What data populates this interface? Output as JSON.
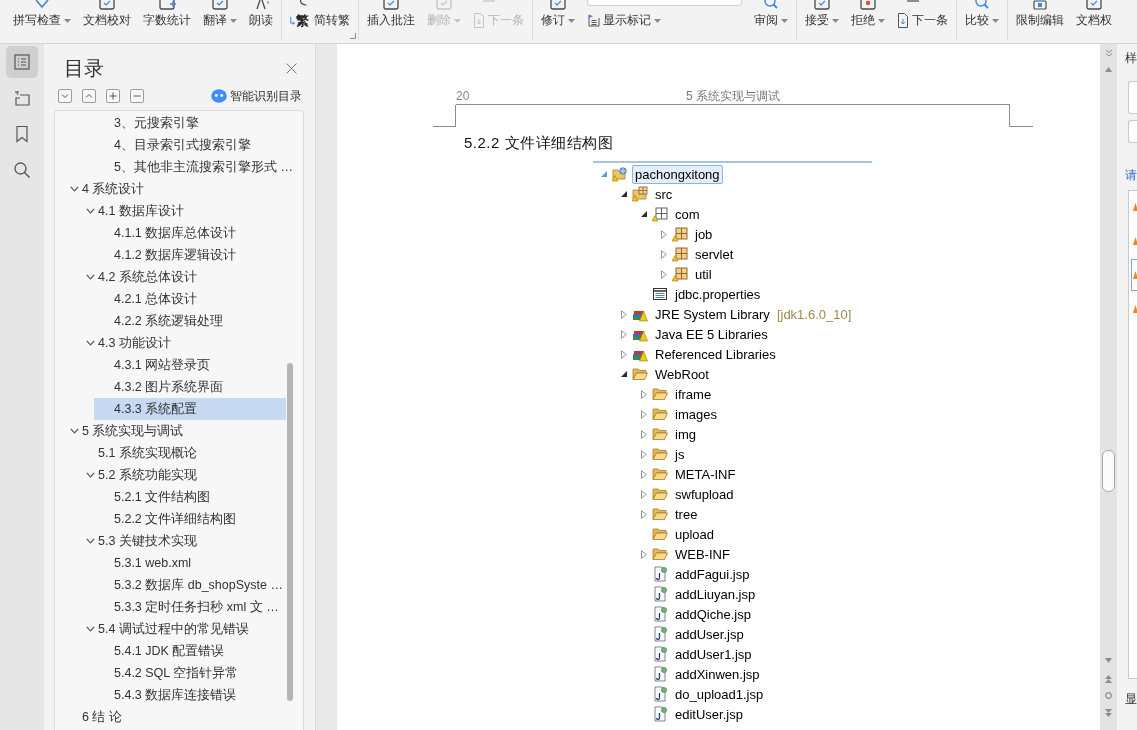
{
  "toolbar": {
    "groups": [
      {
        "items": [
          {
            "label": "拼写检查",
            "kind": "large",
            "dropdown": true,
            "disabled": false
          },
          {
            "label": "文档校对",
            "kind": "large",
            "dropdown": false,
            "disabled": false
          },
          {
            "label": "字数统计",
            "kind": "large",
            "dropdown": false,
            "disabled": false
          },
          {
            "label": "翻译",
            "kind": "large",
            "dropdown": true,
            "disabled": false
          },
          {
            "label": "朗读",
            "kind": "large",
            "dropdown": false,
            "disabled": false
          }
        ]
      },
      {
        "launcher": true,
        "items": [
          {
            "label": "简转繁",
            "kind": "glyph",
            "glyph": "繁",
            "dropdown": false,
            "disabled": false
          }
        ]
      },
      {
        "items": [
          {
            "label": "插入批注",
            "kind": "large",
            "dropdown": false,
            "disabled": false
          },
          {
            "label": "删除",
            "kind": "large",
            "dropdown": true,
            "disabled": true
          },
          {
            "label": "下一条",
            "kind": "small",
            "dropdown": false,
            "disabled": true
          }
        ]
      },
      {
        "items": [
          {
            "label": "修订",
            "kind": "large",
            "dropdown": true,
            "disabled": false
          },
          {
            "label": "显示标记",
            "kind": "field",
            "dropdown": true,
            "disabled": false
          },
          {
            "label": "审阅",
            "kind": "large",
            "dropdown": true,
            "disabled": false
          }
        ]
      },
      {
        "items": [
          {
            "label": "接受",
            "kind": "large",
            "dropdown": true,
            "disabled": false
          },
          {
            "label": "拒绝",
            "kind": "large",
            "dropdown": true,
            "disabled": false
          },
          {
            "label": "下一条",
            "kind": "small",
            "dropdown": false,
            "disabled": false
          }
        ]
      },
      {
        "items": [
          {
            "label": "比较",
            "kind": "large",
            "dropdown": true,
            "disabled": false
          }
        ]
      },
      {
        "items": [
          {
            "label": "限制编辑",
            "kind": "large",
            "dropdown": false,
            "disabled": false
          },
          {
            "label": "文档权",
            "kind": "large",
            "dropdown": false,
            "disabled": false
          }
        ]
      }
    ]
  },
  "nav_strip": {
    "tabs": [
      {
        "selected": true
      },
      {
        "selected": false
      },
      {
        "selected": false
      },
      {
        "selected": false
      }
    ]
  },
  "toc_panel": {
    "title": "目录",
    "smart_toc": "智能识别目录",
    "continued_items": [
      {
        "label": "3、元搜索引擎",
        "selected": false
      },
      {
        "label": "4、目录索引式搜索引擎",
        "selected": false
      },
      {
        "label": "5、其他非主流搜索引擎形式 …",
        "selected": false
      }
    ],
    "items": [
      {
        "label": "4 系统设计",
        "expanded": true,
        "selected": false,
        "children": [
          {
            "label": "4.1 数据库设计",
            "expanded": true,
            "selected": false,
            "children": [
              {
                "label": "4.1.1 数据库总体设计",
                "selected": false
              },
              {
                "label": "4.1.2 数据库逻辑设计",
                "selected": false
              }
            ]
          },
          {
            "label": "4.2 系统总体设计",
            "expanded": true,
            "selected": false,
            "children": [
              {
                "label": "4.2.1 总体设计",
                "selected": false
              },
              {
                "label": "4.2.2 系统逻辑处理",
                "selected": false
              }
            ]
          },
          {
            "label": "4.3 功能设计",
            "expanded": true,
            "selected": false,
            "children": [
              {
                "label": "4.3.1 网站登录页",
                "selected": false
              },
              {
                "label": "4.3.2 图片系统界面",
                "selected": false
              },
              {
                "label": "4.3.3 系统配置",
                "selected": true
              }
            ]
          }
        ]
      },
      {
        "label": "5 系统实现与调试",
        "expanded": true,
        "selected": false,
        "children": [
          {
            "label": "5.1 系统实现概论",
            "selected": false
          },
          {
            "label": "5.2 系统功能实现",
            "expanded": true,
            "selected": false,
            "children": [
              {
                "label": "5.2.1 文件结构图",
                "selected": false
              },
              {
                "label": "5.2.2 文件详细结构图",
                "selected": false
              }
            ]
          },
          {
            "label": "5.3 关键技术实现",
            "expanded": true,
            "selected": false,
            "children": [
              {
                "label": "5.3.1 web.xml",
                "selected": false
              },
              {
                "label": "5.3.2 数据库 db_shopSyste …",
                "selected": false
              },
              {
                "label": "5.3.3 定时任务扫秒 xml 文 …",
                "selected": false
              }
            ]
          },
          {
            "label": "5.4 调试过程中的常见错误",
            "expanded": true,
            "selected": false,
            "children": [
              {
                "label": "5.4.1 JDK 配置错误",
                "selected": false
              },
              {
                "label": "5.4.2 SQL 空指针异常",
                "selected": false
              },
              {
                "label": "5.4.3 数据库连接错误",
                "selected": false
              }
            ]
          }
        ]
      },
      {
        "label": "6 结 论",
        "selected": false
      }
    ]
  },
  "document": {
    "header": {
      "page_number": "20",
      "chapter": "5 系统实现与调试"
    },
    "heading": "5.2.2 文件详细结构图",
    "figure": {
      "tree": [
        {
          "label": "pachongxitong",
          "kind": "project",
          "expanded": true,
          "selected": true,
          "children": [
            {
              "label": "src",
              "kind": "source-folder",
              "expanded": true,
              "selected": false,
              "children": [
                {
                  "label": "com",
                  "kind": "empty-package",
                  "expanded": true,
                  "selected": false,
                  "children": [
                    {
                      "label": "job",
                      "kind": "package",
                      "expanded": false,
                      "selected": false
                    },
                    {
                      "label": "servlet",
                      "kind": "package",
                      "expanded": false,
                      "selected": false
                    },
                    {
                      "label": "util",
                      "kind": "package",
                      "expanded": false,
                      "selected": false
                    }
                  ]
                },
                {
                  "label": "jdbc.properties",
                  "kind": "properties",
                  "selected": false
                }
              ]
            },
            {
              "label": "JRE System Library",
              "decoration": "[jdk1.6.0_10]",
              "kind": "library",
              "expanded": false,
              "selected": false
            },
            {
              "label": "Java EE 5 Libraries",
              "kind": "library",
              "expanded": false,
              "selected": false
            },
            {
              "label": "Referenced Libraries",
              "kind": "library",
              "expanded": false,
              "selected": false
            },
            {
              "label": "WebRoot",
              "kind": "folder",
              "expanded": true,
              "selected": false,
              "children": [
                {
                  "label": "iframe",
                  "kind": "folder",
                  "expanded": false,
                  "selected": false
                },
                {
                  "label": "images",
                  "kind": "folder",
                  "expanded": false,
                  "selected": false
                },
                {
                  "label": "img",
                  "kind": "folder",
                  "expanded": false,
                  "selected": false
                },
                {
                  "label": "js",
                  "kind": "folder",
                  "expanded": false,
                  "selected": false
                },
                {
                  "label": "META-INF",
                  "kind": "folder",
                  "expanded": false,
                  "selected": false
                },
                {
                  "label": "swfupload",
                  "kind": "folder",
                  "expanded": false,
                  "selected": false
                },
                {
                  "label": "tree",
                  "kind": "folder",
                  "expanded": false,
                  "selected": false
                },
                {
                  "label": "upload",
                  "kind": "folder",
                  "selected": false
                },
                {
                  "label": "WEB-INF",
                  "kind": "folder",
                  "expanded": false,
                  "selected": false
                },
                {
                  "label": "addFagui.jsp",
                  "kind": "jsp",
                  "selected": false
                },
                {
                  "label": "addLiuyan.jsp",
                  "kind": "jsp",
                  "selected": false
                },
                {
                  "label": "addQiche.jsp",
                  "kind": "jsp",
                  "selected": false
                },
                {
                  "label": "addUser.jsp",
                  "kind": "jsp",
                  "selected": false
                },
                {
                  "label": "addUser1.jsp",
                  "kind": "jsp",
                  "selected": false
                },
                {
                  "label": "addXinwen.jsp",
                  "kind": "jsp",
                  "selected": false
                },
                {
                  "label": "do_upload1.jsp",
                  "kind": "jsp",
                  "selected": false
                },
                {
                  "label": "editUser.jsp",
                  "kind": "jsp",
                  "selected": false
                }
              ]
            }
          ]
        }
      ]
    }
  },
  "styles_pane": {
    "title": "样",
    "section": "请",
    "style_items": [
      {
        "selected": false
      },
      {
        "selected": false
      },
      {
        "selected": true
      },
      {
        "selected": false
      }
    ],
    "footer": "显"
  }
}
